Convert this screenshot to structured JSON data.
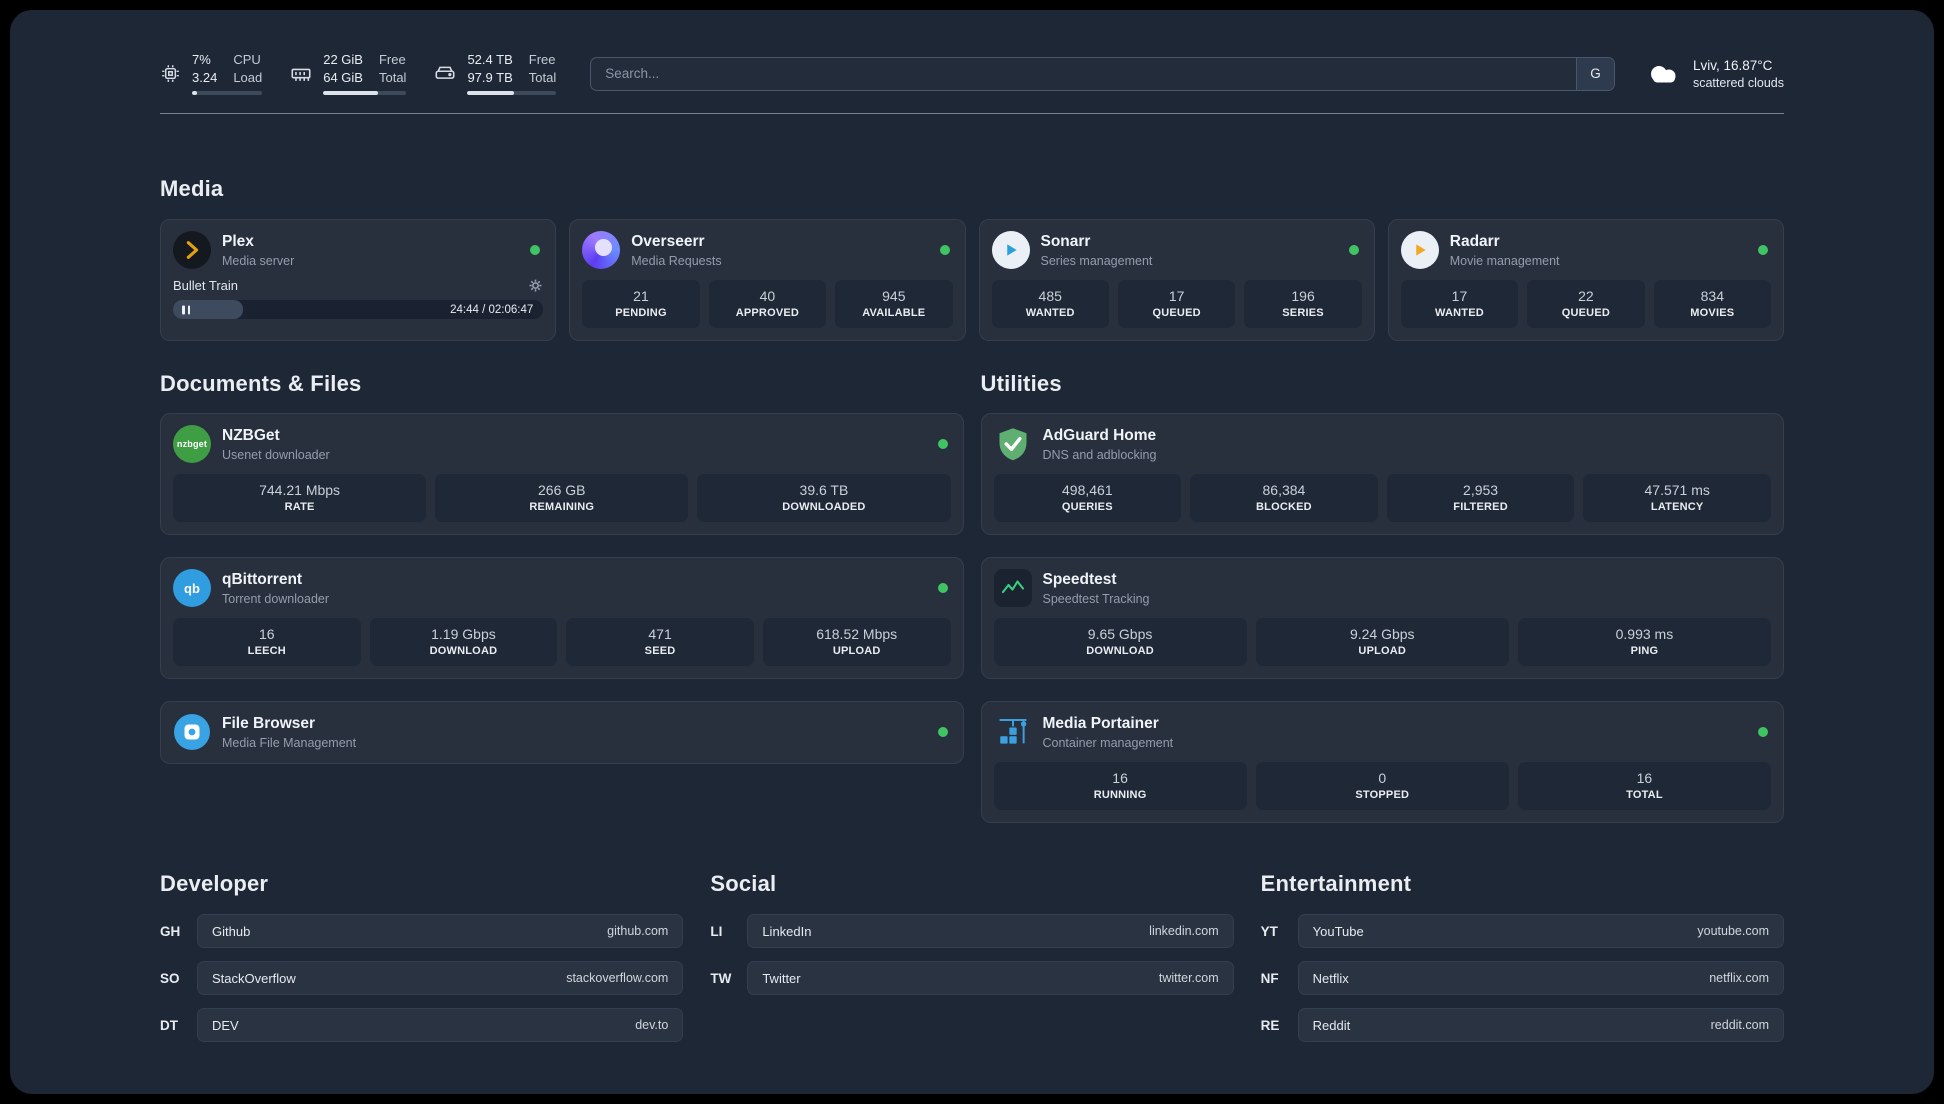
{
  "palette": {
    "background": "#1e2735",
    "card": "#28303e",
    "stat_tile": "#1f2836",
    "status_green": "#40c463",
    "plex_amber": "#e5a00d",
    "overseerr_purple": "#5b3df0",
    "sonarr_blue": "#2b9fd8",
    "radarr_amber": "#f5a623",
    "nzbget_green": "#3f9d44",
    "qbittorrent_blue": "#2f9de0",
    "adguard_green": "#5fae72",
    "speedtest_green": "#35d07f",
    "filebrowser_blue": "#3aa3e3",
    "portainer_blue": "#3b9fe0"
  },
  "header": {
    "cpu": {
      "icon": "cpu-chip-icon",
      "value_top": "7%",
      "value_bottom": "3.24",
      "label_top": "CPU",
      "label_bottom": "Load",
      "bar_style": "width:7%"
    },
    "memory": {
      "icon": "memory-icon",
      "value_top": "22 GiB",
      "value_bottom": "64 GiB",
      "label_top": "Free",
      "label_bottom": "Total",
      "bar_style": "width:66%"
    },
    "storage": {
      "icon": "hard-drive-icon",
      "value_top": "52.4 TB",
      "value_bottom": "97.9 TB",
      "label_top": "Free",
      "label_bottom": "Total",
      "bar_style": "width:52%"
    },
    "search": {
      "placeholder": "Search...",
      "button_label": "G"
    },
    "weather": {
      "icon": "cloud-icon",
      "location": "Lviv, 16.87°C",
      "condition": "scattered clouds"
    }
  },
  "media": {
    "title": "Media",
    "plex": {
      "name": "Plex",
      "subtitle": "Media server",
      "status": "online",
      "now_playing": {
        "title": "Bullet Train",
        "time": "24:44 / 02:06:47",
        "progress_style": "width:19%"
      }
    },
    "overseerr": {
      "name": "Overseerr",
      "subtitle": "Media Requests",
      "status": "online",
      "stats": [
        {
          "value": "21",
          "label": "PENDING"
        },
        {
          "value": "40",
          "label": "APPROVED"
        },
        {
          "value": "945",
          "label": "AVAILABLE"
        }
      ]
    },
    "sonarr": {
      "name": "Sonarr",
      "subtitle": "Series management",
      "status": "online",
      "stats": [
        {
          "value": "485",
          "label": "WANTED"
        },
        {
          "value": "17",
          "label": "QUEUED"
        },
        {
          "value": "196",
          "label": "SERIES"
        }
      ]
    },
    "radarr": {
      "name": "Radarr",
      "subtitle": "Movie management",
      "status": "online",
      "stats": [
        {
          "value": "17",
          "label": "WANTED"
        },
        {
          "value": "22",
          "label": "QUEUED"
        },
        {
          "value": "834",
          "label": "MOVIES"
        }
      ]
    }
  },
  "documents": {
    "title": "Documents & Files",
    "nzbget": {
      "name": "NZBGet",
      "subtitle": "Usenet downloader",
      "status": "online",
      "icon_text": "nzbget",
      "stats": [
        {
          "value": "744.21 Mbps",
          "label": "RATE"
        },
        {
          "value": "266 GB",
          "label": "REMAINING"
        },
        {
          "value": "39.6 TB",
          "label": "DOWNLOADED"
        }
      ]
    },
    "qbittorrent": {
      "name": "qBittorrent",
      "subtitle": "Torrent downloader",
      "status": "online",
      "icon_text": "qb",
      "stats": [
        {
          "value": "16",
          "label": "LEECH"
        },
        {
          "value": "1.19 Gbps",
          "label": "DOWNLOAD"
        },
        {
          "value": "471",
          "label": "SEED"
        },
        {
          "value": "618.52 Mbps",
          "label": "UPLOAD"
        }
      ]
    },
    "filebrowser": {
      "name": "File Browser",
      "subtitle": "Media File Management",
      "status": "online"
    }
  },
  "utilities": {
    "title": "Utilities",
    "adguard": {
      "name": "AdGuard Home",
      "subtitle": "DNS and adblocking",
      "stats": [
        {
          "value": "498,461",
          "label": "QUERIES"
        },
        {
          "value": "86,384",
          "label": "BLOCKED"
        },
        {
          "value": "2,953",
          "label": "FILTERED"
        },
        {
          "value": "47.571 ms",
          "label": "LATENCY"
        }
      ]
    },
    "speedtest": {
      "name": "Speedtest",
      "subtitle": "Speedtest Tracking",
      "stats": [
        {
          "value": "9.65 Gbps",
          "label": "DOWNLOAD"
        },
        {
          "value": "9.24 Gbps",
          "label": "UPLOAD"
        },
        {
          "value": "0.993 ms",
          "label": "PING"
        }
      ]
    },
    "portainer": {
      "name": "Media Portainer",
      "subtitle": "Container management",
      "status": "online",
      "stats": [
        {
          "value": "16",
          "label": "RUNNING"
        },
        {
          "value": "0",
          "label": "STOPPED"
        },
        {
          "value": "16",
          "label": "TOTAL"
        }
      ]
    }
  },
  "bookmarks": [
    {
      "title": "Developer",
      "links": [
        {
          "abbr": "GH",
          "name": "Github",
          "url": "github.com"
        },
        {
          "abbr": "SO",
          "name": "StackOverflow",
          "url": "stackoverflow.com"
        },
        {
          "abbr": "DT",
          "name": "DEV",
          "url": "dev.to"
        }
      ]
    },
    {
      "title": "Social",
      "links": [
        {
          "abbr": "LI",
          "name": "LinkedIn",
          "url": "linkedin.com"
        },
        {
          "abbr": "TW",
          "name": "Twitter",
          "url": "twitter.com"
        }
      ]
    },
    {
      "title": "Entertainment",
      "links": [
        {
          "abbr": "YT",
          "name": "YouTube",
          "url": "youtube.com"
        },
        {
          "abbr": "NF",
          "name": "Netflix",
          "url": "netflix.com"
        },
        {
          "abbr": "RE",
          "name": "Reddit",
          "url": "reddit.com"
        }
      ]
    }
  ]
}
